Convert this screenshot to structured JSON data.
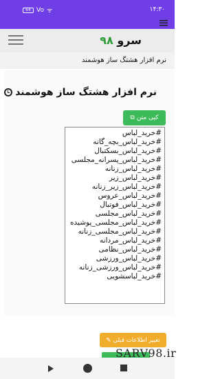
{
  "status_bar": {
    "time": "۱۴:۳۰",
    "battery": "64",
    "signal_label": "Vo",
    "wifi_label": "ᯤ"
  },
  "header": {
    "brand_word": "سرو",
    "brand_number": "۹۸",
    "subtitle": "نرم افزار هشتگ ساز هوشمند"
  },
  "card": {
    "title": "نرم افزار هشتگ ساز هوشمند",
    "copy_button": "کپی متن"
  },
  "hashtags_text": "#خرید_لباس\n#خرید_لباس_بچه_گانه\n#خرید_لباس_بسکتبال\n#خرید_لباس_پسرانه_مجلسی\n#خرید_لباس_زنانه\n#خرید_لباس_زیر\n#خرید_لباس_زیر_زنانه\n#خرید_لباس_عروس\n#خرید_لباس_فوتبال\n#خرید_لباس_مجلسی\n#خرید_لباس_مجلسی_پوشیده\n#خرید_لباس_مجلسی_زنانه\n#خرید_لباس_مردانه\n#خرید_لباس_نظامی\n#خرید_لباس_ورزشی\n#خرید_لباس_ورزشی_زنانه\n#خرید_لباسشویی",
  "change_button": "تغییر اطلاعات قبلی",
  "watermark": "SARV98.ir",
  "colors": {
    "accent": "#6f3ee6",
    "green": "#3dba5a",
    "orange": "#f0ad2c"
  }
}
